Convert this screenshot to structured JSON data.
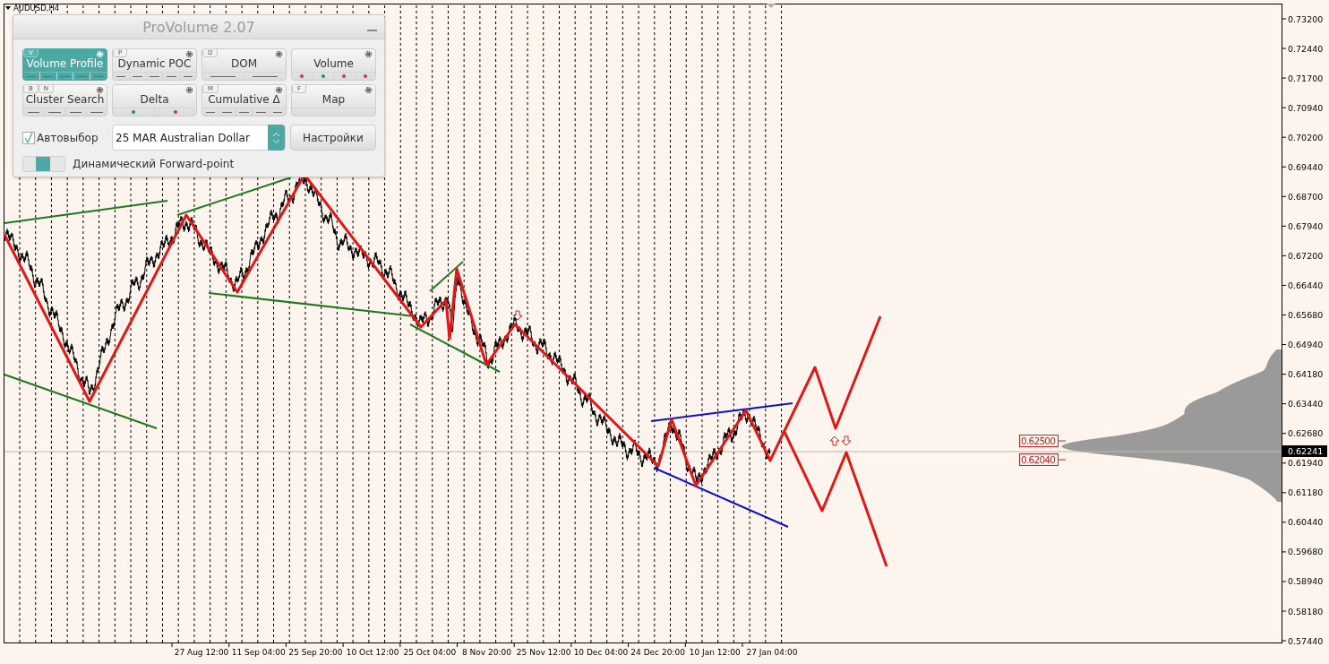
{
  "chart": {
    "symbol": "AUDUSD,H4",
    "price_axis": [
      "0.73200",
      "0.72440",
      "0.71700",
      "0.70940",
      "0.70200",
      "0.69440",
      "0.68700",
      "0.67940",
      "0.67200",
      "0.66440",
      "0.65680",
      "0.64940",
      "0.64180",
      "0.63440",
      "0.62680",
      "0.61940",
      "0.61180",
      "0.60440",
      "0.59680",
      "0.58940",
      "0.58180",
      "0.57440"
    ],
    "current_price": "0.62241",
    "time_axis": [
      "27 Aug 12:00",
      "11 Sep 04:00",
      "25 Sep 20:00",
      "10 Oct 12:00",
      "25 Oct 04:00",
      "8 Nov 20:00",
      "25 Nov 12:00",
      "10 Dec 04:00",
      "24 Dec 20:00",
      "10 Jan 12:00",
      "27 Jan 04:00"
    ],
    "level_labels": [
      "0.62500",
      "0.62040"
    ]
  },
  "panel": {
    "title": "ProVolume 2.07",
    "buttons": [
      {
        "label": "Volume Profile",
        "hotkeys": [
          "V"
        ],
        "selected": true,
        "marks": [
          {
            "kind": "dash",
            "color": "#2f8f3f"
          },
          {
            "kind": "dash",
            "color": "#c83c3c"
          },
          {
            "kind": "dash",
            "color": "#c83c3c"
          },
          {
            "kind": "dash",
            "color": "#c83c3c"
          },
          {
            "kind": "dash",
            "color": "#c83c3c"
          }
        ]
      },
      {
        "label": "Dynamic POC",
        "hotkeys": [
          "P"
        ],
        "selected": false,
        "marks": [
          {
            "kind": "dash",
            "color": "#c83c3c"
          },
          {
            "kind": "dash",
            "color": "#c83c3c"
          },
          {
            "kind": "dash",
            "color": "#c83c3c"
          },
          {
            "kind": "dash",
            "color": "#c83c3c"
          },
          {
            "kind": "dash",
            "color": "#c83c3c"
          }
        ]
      },
      {
        "label": "DOM",
        "hotkeys": [
          "D"
        ],
        "selected": false,
        "marks": [
          {
            "kind": "dash",
            "color": "#2f8f3f"
          },
          {
            "kind": "dash",
            "color": "#c83c3c"
          }
        ]
      },
      {
        "label": "Volume",
        "selected": false,
        "marks": [
          {
            "kind": "dot",
            "color": "#c83c3c"
          },
          {
            "kind": "dot",
            "color": "#2f8f3f"
          },
          {
            "kind": "dot",
            "color": "#c83c3c"
          },
          {
            "kind": "dot",
            "color": "#c83c3c"
          }
        ]
      },
      {
        "label": "Cluster Search",
        "hotkeys": [
          "B",
          "N"
        ],
        "selected": false,
        "marks": [
          {
            "kind": "dash",
            "color": "#c83c3c"
          },
          {
            "kind": "dash",
            "color": "#c83c3c"
          },
          {
            "kind": "dash",
            "color": "#c83c3c"
          },
          {
            "kind": "dash",
            "color": "#c83c3c"
          }
        ]
      },
      {
        "label": "Delta",
        "selected": false,
        "marks": [
          {
            "kind": "dot",
            "color": "#2f8f3f"
          },
          {
            "kind": "dot",
            "color": "#c83c3c"
          }
        ]
      },
      {
        "label": "Cumulative Δ",
        "hotkeys": [
          "M"
        ],
        "selected": false,
        "marks": [
          {
            "kind": "dash",
            "color": "#2f8f3f"
          },
          {
            "kind": "dash",
            "color": "#c83c3c"
          },
          {
            "kind": "dash",
            "color": "#2f8f3f"
          },
          {
            "kind": "dash",
            "color": "#c83c3c"
          },
          {
            "kind": "dash",
            "color": "#c83c3c"
          }
        ]
      },
      {
        "label": "Map",
        "hotkeys": [
          "F"
        ],
        "selected": false
      }
    ],
    "autoselect": {
      "label": "Автовыбор",
      "checked": true
    },
    "instrument": {
      "value": "25 MAR Australian Dollar"
    },
    "settings_button": "Настройки",
    "forward_point": {
      "label": "Динамический Forward-point",
      "on": true
    }
  }
}
